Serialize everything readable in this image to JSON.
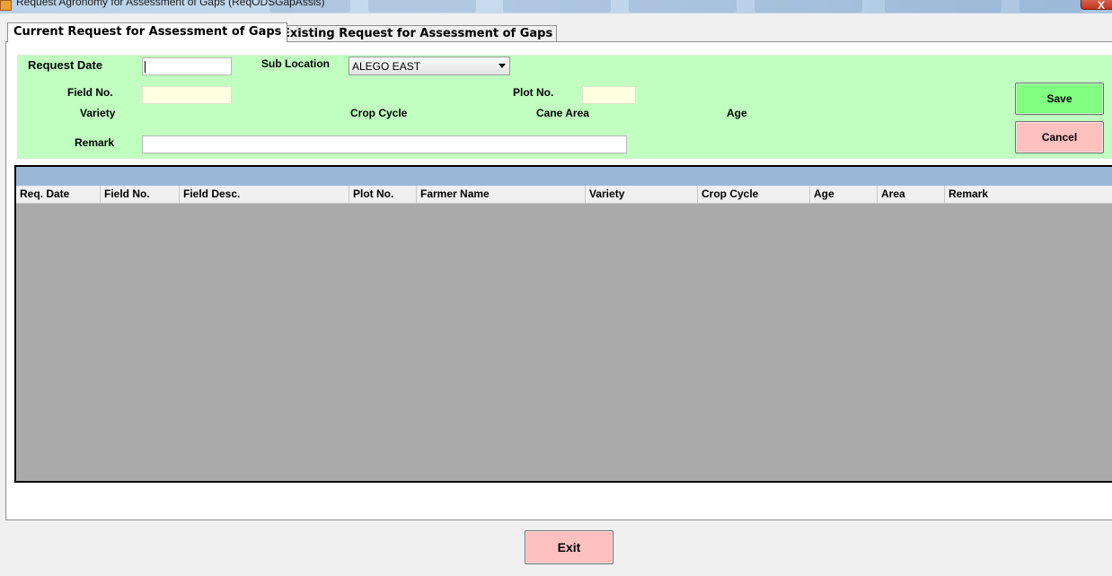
{
  "window": {
    "title": "Request Agronomy for Assessment of Gaps (ReqODSGapAssis)",
    "close_label": "X"
  },
  "tabs": [
    {
      "label": "Current Request for Assessment of Gaps",
      "active": true
    },
    {
      "label": "Existing Request for Assessment of Gaps",
      "active": false
    }
  ],
  "form": {
    "request_date_label": "Request Date",
    "request_date_value": "",
    "sub_location_label": "Sub Location",
    "sub_location_value": "ALEGO EAST",
    "field_no_label": "Field No.",
    "field_no_value": "",
    "plot_no_label": "Plot No.",
    "plot_no_value": "",
    "variety_label": "Variety",
    "crop_cycle_label": "Crop Cycle",
    "cane_area_label": "Cane Area",
    "age_label": "Age",
    "remark_label": "Remark",
    "remark_value": "",
    "save_label": "Save",
    "cancel_label": "Cancel"
  },
  "grid": {
    "columns": [
      "Req. Date",
      "Field No.",
      "Field Desc.",
      "Plot No.",
      "Farmer Name",
      "Variety",
      "Crop Cycle",
      "Age",
      "Area",
      "Remark"
    ],
    "rows": []
  },
  "footer": {
    "exit_label": "Exit"
  },
  "colors": {
    "form_background": "#c0ffc0",
    "save_button": "#80ff80",
    "cancel_button": "#ffc0c0",
    "exit_button": "#ffc0c0",
    "grid_caption": "#9ab9d9",
    "grid_background": "#ababab",
    "readonly_field": "#ffffe1"
  }
}
